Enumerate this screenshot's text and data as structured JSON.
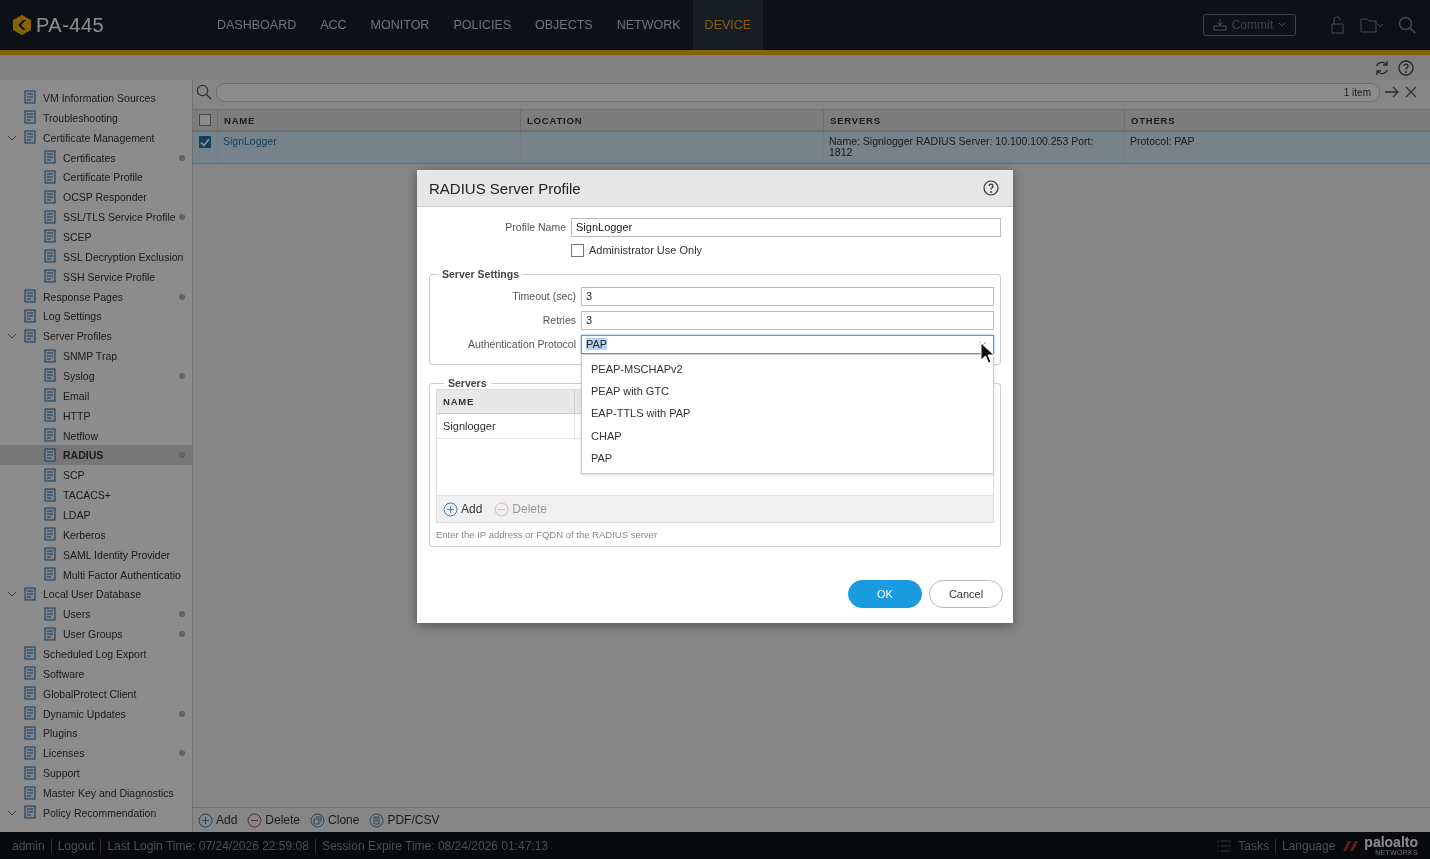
{
  "top_nav": {
    "product": "PA-445",
    "tabs": [
      {
        "label": "DASHBOARD",
        "selected": false
      },
      {
        "label": "ACC",
        "selected": false
      },
      {
        "label": "MONITOR",
        "selected": false
      },
      {
        "label": "POLICIES",
        "selected": false
      },
      {
        "label": "OBJECTS",
        "selected": false
      },
      {
        "label": "NETWORK",
        "selected": false
      },
      {
        "label": "DEVICE",
        "selected": true
      }
    ],
    "commit_button": "Commit"
  },
  "sidebar": {
    "items": [
      {
        "label": "VM Information Sources",
        "dot": false,
        "selected": false
      },
      {
        "label": "Troubleshooting",
        "dot": false,
        "selected": false
      },
      {
        "label": "Certificate Management",
        "dot": false,
        "selected": false,
        "expanded": true,
        "children": [
          {
            "label": "Certificates",
            "dot": true,
            "selected": false
          },
          {
            "label": "Certificate Profile",
            "dot": false,
            "selected": false
          },
          {
            "label": "OCSP Responder",
            "dot": false,
            "selected": false
          },
          {
            "label": "SSL/TLS Service Profile",
            "dot": true,
            "selected": false
          },
          {
            "label": "SCEP",
            "dot": false,
            "selected": false
          },
          {
            "label": "SSL Decryption Exclusion",
            "dot": false,
            "selected": false
          },
          {
            "label": "SSH Service Profile",
            "dot": false,
            "selected": false
          }
        ]
      },
      {
        "label": "Response Pages",
        "dot": true,
        "selected": false
      },
      {
        "label": "Log Settings",
        "dot": false,
        "selected": false
      },
      {
        "label": "Server Profiles",
        "dot": false,
        "selected": false,
        "expanded": true,
        "children": [
          {
            "label": "SNMP Trap",
            "dot": false,
            "selected": false
          },
          {
            "label": "Syslog",
            "dot": true,
            "selected": false
          },
          {
            "label": "Email",
            "dot": false,
            "selected": false
          },
          {
            "label": "HTTP",
            "dot": false,
            "selected": false
          },
          {
            "label": "Netflow",
            "dot": false,
            "selected": false
          },
          {
            "label": "RADIUS",
            "dot": true,
            "selected": true
          },
          {
            "label": "SCP",
            "dot": false,
            "selected": false
          },
          {
            "label": "TACACS+",
            "dot": false,
            "selected": false
          },
          {
            "label": "LDAP",
            "dot": false,
            "selected": false
          },
          {
            "label": "Kerberos",
            "dot": false,
            "selected": false
          },
          {
            "label": "SAML Identity Provider",
            "dot": false,
            "selected": false
          },
          {
            "label": "Multi Factor Authenticatio",
            "dot": false,
            "selected": false
          }
        ]
      },
      {
        "label": "Local User Database",
        "dot": false,
        "selected": false,
        "expanded": true,
        "children": [
          {
            "label": "Users",
            "dot": true,
            "selected": false
          },
          {
            "label": "User Groups",
            "dot": true,
            "selected": false
          }
        ]
      },
      {
        "label": "Scheduled Log Export",
        "dot": false,
        "selected": false
      },
      {
        "label": "Software",
        "dot": false,
        "selected": false
      },
      {
        "label": "GlobalProtect Client",
        "dot": false,
        "selected": false
      },
      {
        "label": "Dynamic Updates",
        "dot": true,
        "selected": false
      },
      {
        "label": "Plugins",
        "dot": false,
        "selected": false
      },
      {
        "label": "Licenses",
        "dot": true,
        "selected": false
      },
      {
        "label": "Support",
        "dot": false,
        "selected": false
      },
      {
        "label": "Master Key and Diagnostics",
        "dot": false,
        "selected": false
      },
      {
        "label": "Policy Recommendation",
        "dot": false,
        "selected": false,
        "expanded": true
      }
    ]
  },
  "search": {
    "count": "1 item"
  },
  "table": {
    "select_all_checked": false,
    "columns": [
      "NAME",
      "LOCATION",
      "SERVERS",
      "OTHERS"
    ],
    "rows": [
      {
        "checked": true,
        "selected": true,
        "name": "SignLogger",
        "servers": "Name: Signlogger RADIUS Server: 10.100.100.253 Port: 1812",
        "others": "Protocol: PAP"
      }
    ]
  },
  "bottom_toolbar": [
    {
      "label": "Add",
      "kind": "add"
    },
    {
      "label": "Delete",
      "kind": "delete"
    },
    {
      "label": "Clone",
      "kind": "clone"
    },
    {
      "label": "PDF/CSV",
      "kind": "export"
    }
  ],
  "dialog": {
    "title": "RADIUS Server Profile",
    "profile_name": {
      "label": "Profile Name",
      "value": "SignLogger"
    },
    "admin_use_only": {
      "label": "Administrator Use Only",
      "checked": false
    },
    "server_settings": {
      "legend": "Server Settings",
      "timeout": {
        "label": "Timeout (sec)",
        "value": "3"
      },
      "retries": {
        "label": "Retries",
        "value": "3"
      },
      "auth_protocol": {
        "label": "Authentication Protocol",
        "value": "PAP",
        "expanded": true,
        "options": [
          "PEAP-MSCHAPv2",
          "PEAP with GTC",
          "EAP-TTLS with PAP",
          "CHAP",
          "PAP"
        ]
      }
    },
    "servers": {
      "legend": "Servers",
      "columns": [
        "NAME"
      ],
      "rows": [
        "Signlogger"
      ],
      "actions": [
        {
          "label": "Add",
          "kind": "add",
          "disabled": false
        },
        {
          "label": "Delete",
          "kind": "delete",
          "disabled": true
        }
      ],
      "help": "Enter the IP address or FQDN of the RADIUS server"
    },
    "buttons": [
      {
        "label": "OK",
        "kind": "primary"
      },
      {
        "label": "Cancel",
        "kind": "secondary"
      }
    ]
  },
  "status_bar": {
    "user": "admin",
    "logout": "Logout",
    "last_login": "Last Login Time: 07/24/2026 22:59:08",
    "session_expire": "Session Expire Time: 08/24/2026 01:47:13",
    "tasks": "Tasks",
    "language": "Language",
    "brand": "paloalto",
    "brand_sub": "NETWORKS"
  }
}
